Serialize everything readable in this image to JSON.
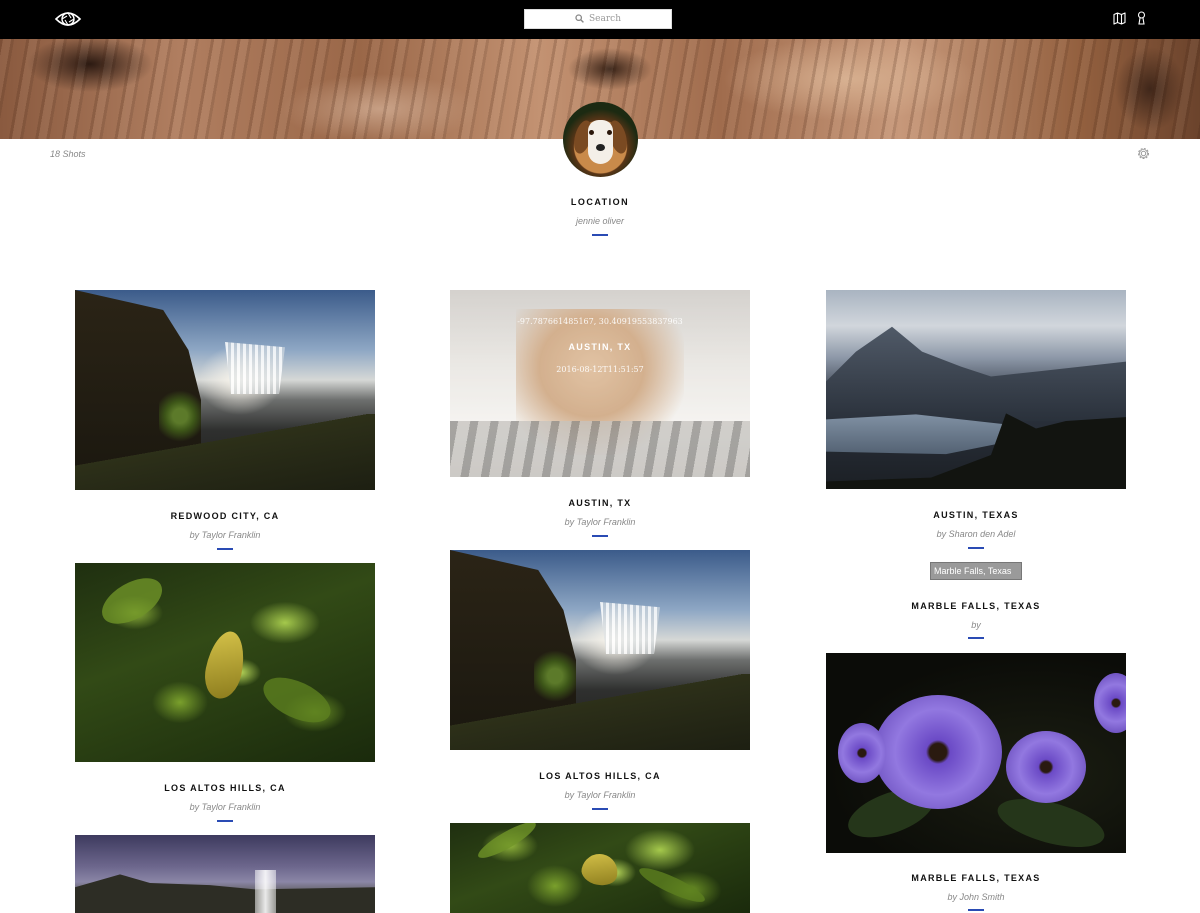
{
  "header": {
    "logo_icon": "eye-aperture-logo",
    "search": {
      "placeholder": "Search",
      "icon": "search-icon"
    },
    "icons": [
      "map-icon",
      "user-icon"
    ]
  },
  "profile": {
    "shots_count": "18 Shots",
    "title": "LOCATION",
    "subtitle": "jennie oliver",
    "settings_icon": "gear-icon",
    "accent_color": "#2a4bb4"
  },
  "columns": [
    {
      "cards": [
        {
          "title": "REDWOOD CITY, CA",
          "by": "by Taylor Franklin",
          "photo": "waterfall"
        },
        {
          "title": "LOS ALTOS HILLS, CA",
          "by": "by Taylor Franklin",
          "photo": "leaves"
        },
        {
          "title": "",
          "by": "",
          "photo": "sky-waterfall"
        }
      ]
    },
    {
      "cards": [
        {
          "title": "AUSTIN, TX",
          "by": "by Taylor Franklin",
          "photo": "dog",
          "overlay": {
            "coords": "-97.787661485167, 30.40919553837963",
            "name": "AUSTIN, TX",
            "date": "2016-08-12T11:51:57"
          }
        },
        {
          "title": "LOS ALTOS HILLS, CA",
          "by": "by Taylor Franklin",
          "photo": "waterfall"
        },
        {
          "title": "",
          "by": "",
          "photo": "leaves"
        }
      ]
    },
    {
      "cards": [
        {
          "title": "AUSTIN, TEXAS",
          "by": "by Sharon den Adel",
          "photo": "lake"
        },
        {
          "title": "MARBLE FALLS, TEXAS",
          "by": "by",
          "photo": "broken",
          "alt": "Marble Falls, Texas"
        },
        {
          "title": "MARBLE FALLS, TEXAS",
          "by": "by John Smith",
          "photo": "flowers"
        }
      ]
    }
  ]
}
